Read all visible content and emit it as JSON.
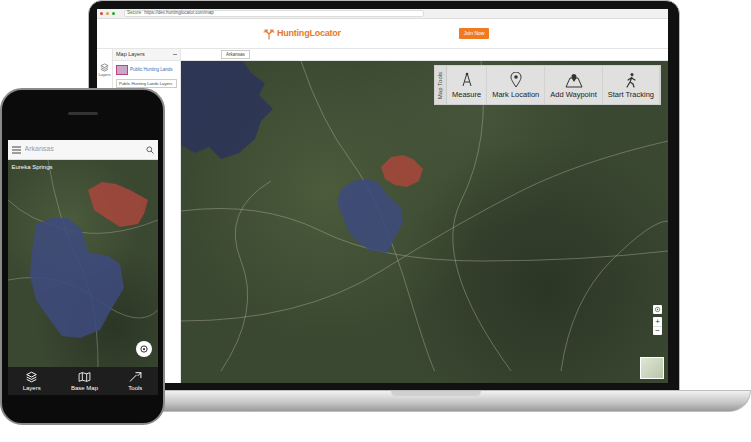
{
  "laptop": {
    "browser": {
      "secure": "Secure",
      "url": "https://dev.huntinglocator.com/map"
    },
    "header": {
      "logo": "HuntingLocator",
      "button": "Join Now"
    },
    "rail": [
      {
        "label": "Layers"
      }
    ],
    "layers_panel": {
      "title": "Map Layers",
      "layer": "Public Hunting Lands",
      "dropdown": "Public Hunting Lands Layers"
    },
    "search": {
      "value": "Arkansas"
    },
    "map_tools": {
      "title": "Map Tools",
      "tools": [
        {
          "label": "Measure"
        },
        {
          "label": "Mark Location"
        },
        {
          "label": "Add Waypoint"
        },
        {
          "label": "Start Tracking"
        }
      ]
    },
    "zoom": [
      "+",
      "−"
    ],
    "map": {
      "areas": [
        {
          "color": "#2b3459"
        },
        {
          "color": "#3d4a7c"
        },
        {
          "color": "#a5473b"
        }
      ]
    }
  },
  "phone": {
    "search": {
      "placeholder": "Arkansas"
    },
    "map": {
      "labels": [
        "Eureka Springs"
      ],
      "areas": [
        {
          "color": "#a5473b"
        },
        {
          "color": "#3d4a7c"
        }
      ]
    },
    "tabs": [
      {
        "label": "Layers"
      },
      {
        "label": "Base Map"
      },
      {
        "label": "Tools"
      }
    ]
  }
}
